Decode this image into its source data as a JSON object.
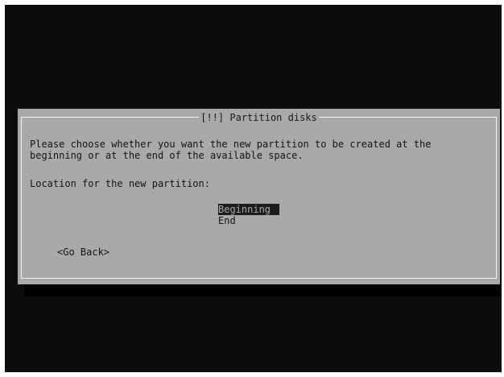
{
  "dialog": {
    "title": "[!!] Partition disks",
    "message_line1": "Please choose whether you want the new partition to be created at the",
    "message_line2": "beginning or at the end of the available space.",
    "prompt": "Location for the new partition:",
    "options": [
      {
        "label": "Beginning",
        "selected": true
      },
      {
        "label": "End",
        "selected": false
      }
    ],
    "back_button": "<Go Back>"
  },
  "colors": {
    "screen_background": "#0c0c0c",
    "dialog_background": "#a9a9a9",
    "selection_background": "#1c1c1c",
    "text": "#141414"
  }
}
